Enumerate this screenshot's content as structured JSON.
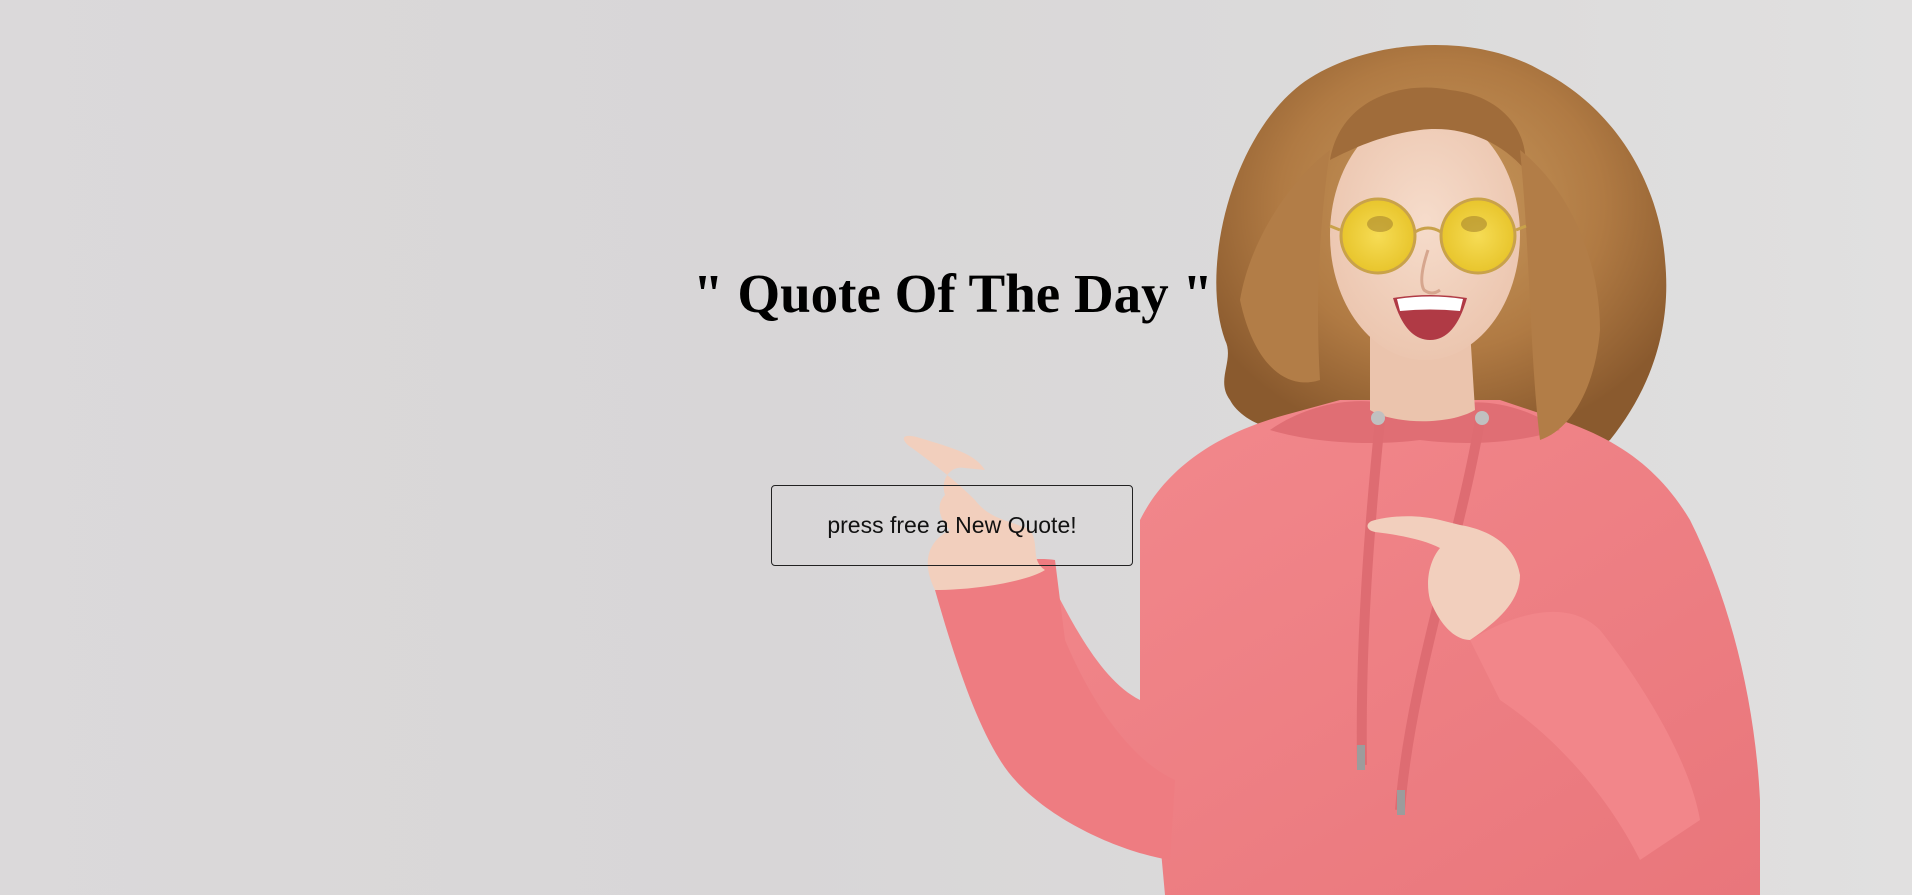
{
  "hero": {
    "title": "\" Quote Of The Day \"",
    "photo_description": "smiling woman with curly hair, yellow round sunglasses and pink hoodie pointing left",
    "colors": {
      "background": "#dad8d9",
      "hoodie": "#f07f84",
      "hair": "#b5814a",
      "glasses": "#f0cf3a"
    }
  },
  "quote_button": {
    "label": "press free a New Quote!"
  }
}
